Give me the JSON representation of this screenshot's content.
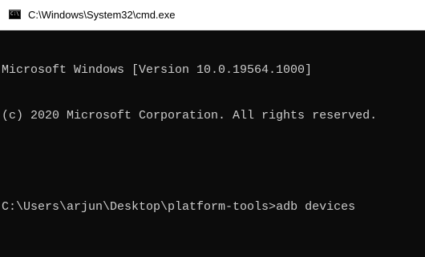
{
  "window": {
    "title": "C:\\Windows\\System32\\cmd.exe",
    "icon": "command-prompt-icon",
    "icon_glyph": "C:\\."
  },
  "console": {
    "header_line1": "Microsoft Windows [Version 10.0.19564.1000]",
    "header_line2": "(c) 2020 Microsoft Corporation. All rights reserved.",
    "prompt": "C:\\Users\\arjun\\Desktop\\platform-tools>",
    "command": "adb devices"
  },
  "colors": {
    "console_background": "#0c0c0c",
    "console_text": "#cccccc",
    "titlebar_background": "#ffffff"
  }
}
